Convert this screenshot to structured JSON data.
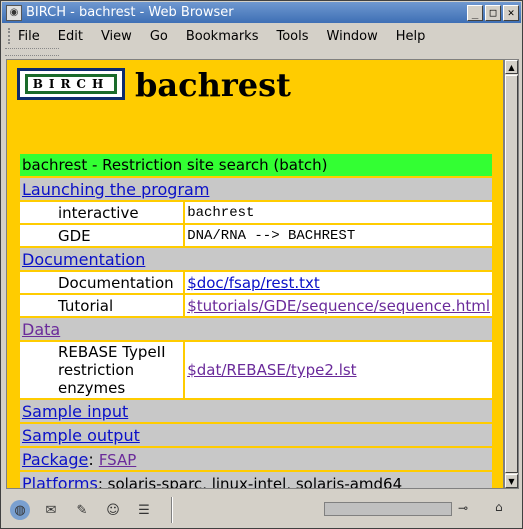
{
  "window": {
    "title": "BIRCH - bachrest - Web Browser"
  },
  "menu": [
    "File",
    "Edit",
    "View",
    "Go",
    "Bookmarks",
    "Tools",
    "Window",
    "Help"
  ],
  "page": {
    "logo_text": "BIRCH",
    "title": "bachrest",
    "heading": "bachrest - Restriction site search (batch)",
    "launching": "Launching the program",
    "interactive_label": "interactive",
    "interactive_value": "bachrest",
    "gde_label": "GDE",
    "gde_value": "DNA/RNA --> BACHREST",
    "documentation": "Documentation",
    "doc_label": "Documentation",
    "doc_value": "$doc/fsap/rest.txt",
    "tutorial_label": "Tutorial",
    "tutorial_value": "$tutorials/GDE/sequence/sequence.html",
    "data": "Data",
    "rebase_label": "REBASE TypeII restriction enzymes",
    "rebase_value": "$dat/REBASE/type2.lst",
    "sample_input": "Sample input",
    "sample_output": "Sample output",
    "package_label": "Package",
    "package_value": "FSAP",
    "platforms_label": "Platforms",
    "platforms_value": ": solaris-sparc, linux-intel, solaris-amd64"
  },
  "colors": {
    "page_bg": "#ffcc00",
    "heading_bg": "#33ff33",
    "section_bg": "#c8c8c8",
    "link": "#0a10c8",
    "visited": "#6a2a9a"
  }
}
